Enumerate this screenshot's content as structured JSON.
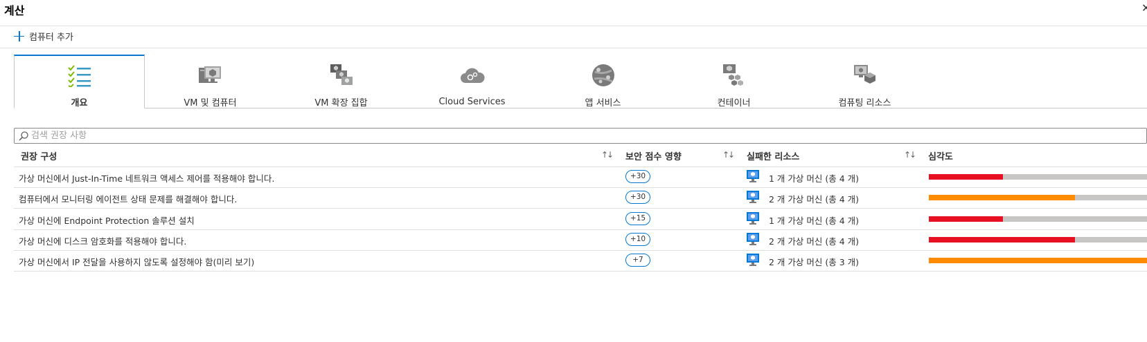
{
  "window": {
    "title": "계산",
    "close_icon": "close-icon"
  },
  "toolbar": {
    "add_label": "컴퓨터 추가",
    "add_icon": "plus-icon"
  },
  "tabs": [
    {
      "label": "개요",
      "icon": "list-check-icon",
      "active": true
    },
    {
      "label": "VM 및 컴퓨터",
      "icon": "vm-computer-icon",
      "active": false
    },
    {
      "label": "VM 확장 집합",
      "icon": "vm-scale-set-icon",
      "active": false
    },
    {
      "label": "Cloud Services",
      "icon": "cloud-services-icon",
      "active": false
    },
    {
      "label": "앱 서비스",
      "icon": "app-services-icon",
      "active": false
    },
    {
      "label": "컨테이너",
      "icon": "containers-icon",
      "active": false
    },
    {
      "label": "컴퓨팅 리소스",
      "icon": "compute-resources-icon",
      "active": false
    }
  ],
  "search": {
    "placeholder": "검색 권장 사항",
    "value": ""
  },
  "table": {
    "columns": [
      "권장 구성",
      "보안 점수 영향",
      "실패한 리소스",
      "심각도"
    ],
    "rows": [
      {
        "recommendation": "가상 머신에서 Just-In-Time 네트워크 액세스 제어를 적용해야 합니다.",
        "score": "+30",
        "resources": "1 개 가상 머신 (총 4 개)",
        "severity_color": "#e81123",
        "severity_fraction": 0.34
      },
      {
        "recommendation": "컴퓨터에서 모니터링 에이전트 상태 문제를 해결해야 합니다.",
        "score": "+30",
        "resources": "2 개 가상 머신 (총 4 개)",
        "severity_color": "#ff8c00",
        "severity_fraction": 0.67
      },
      {
        "recommendation": "가상 머신에 Endpoint Protection 솔루션 설치",
        "score": "+15",
        "resources": "1 개 가상 머신 (총 4 개)",
        "severity_color": "#e81123",
        "severity_fraction": 0.34
      },
      {
        "recommendation": "가상 머신에 디스크 암호화를 적용해야 합니다.",
        "score": "+10",
        "resources": "2 개 가상 머신 (총 4 개)",
        "severity_color": "#e81123",
        "severity_fraction": 0.67
      },
      {
        "recommendation": "가상 머신에서 IP 전달을 사용하지 않도록 설정해야 함(미리 보기)",
        "score": "+7",
        "resources": "2 개 가상 머신 (총 3 개)",
        "severity_color": "#ff8c00",
        "severity_fraction": 1.0
      }
    ]
  }
}
